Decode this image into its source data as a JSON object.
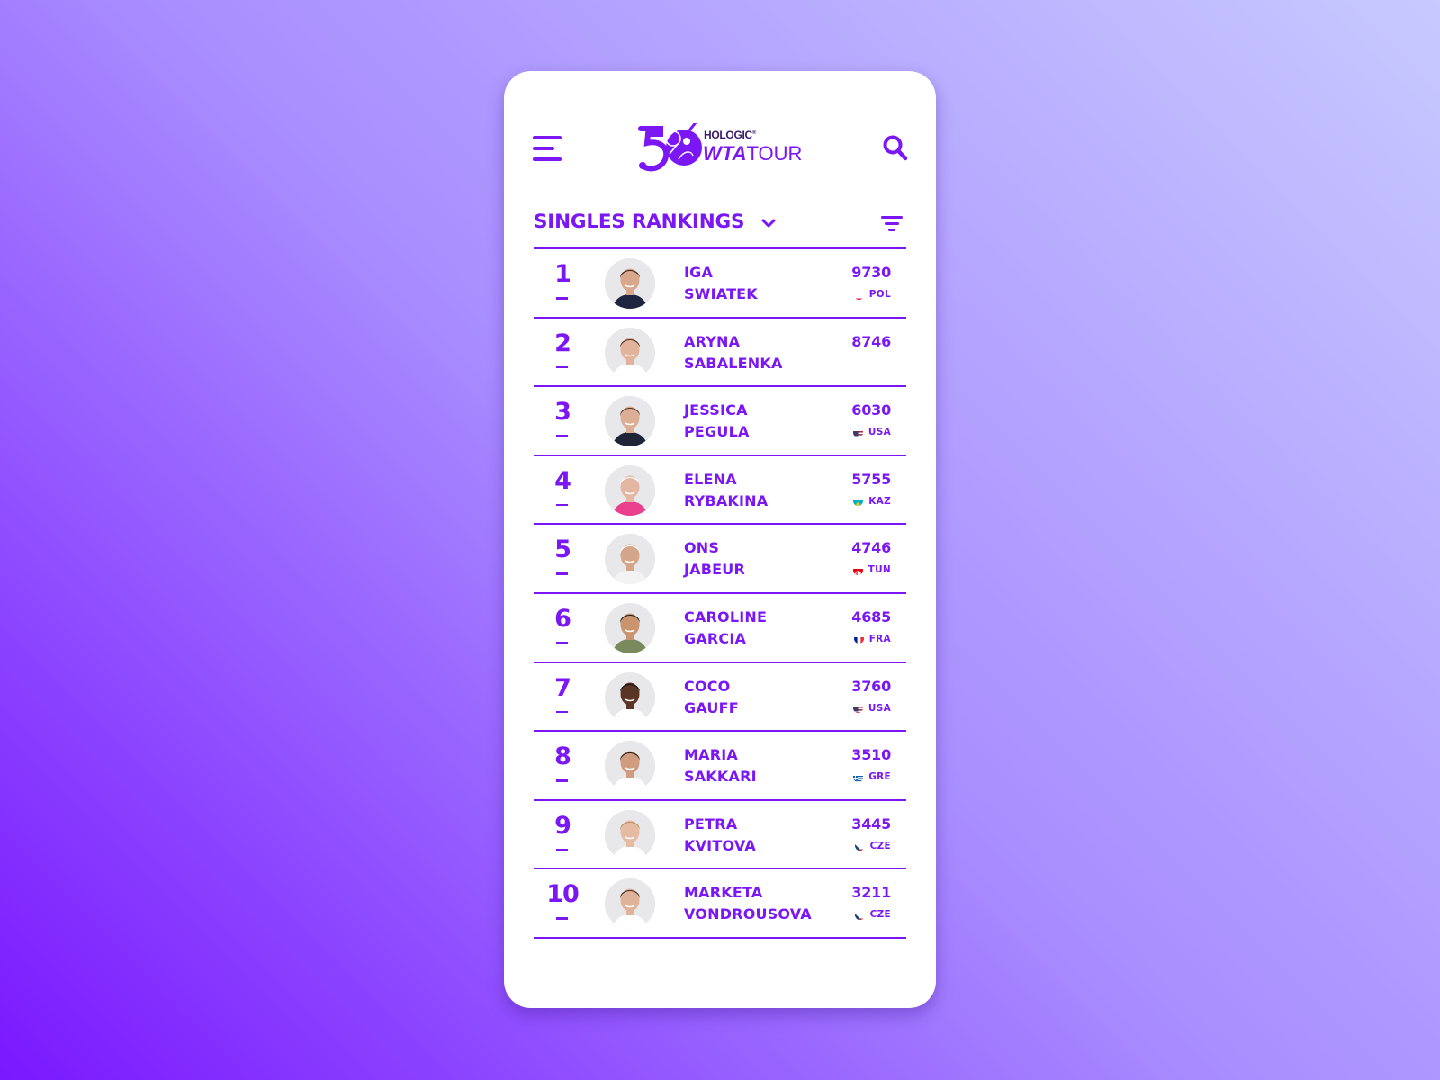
{
  "theme": {
    "accent": "#7b16f5",
    "background_from": "#7a17ff",
    "background_to": "#c7c9ff",
    "card": "#ffffff"
  },
  "header": {
    "menu_icon": "hamburger-menu-icon",
    "logo": {
      "number": "50",
      "sponsor": "HOLOGIC",
      "registered": "®",
      "brand_bold": "WTA",
      "brand_light": "TOUR"
    },
    "search_icon": "search-icon"
  },
  "section": {
    "title": "SINGLES RANKINGS",
    "dropdown_icon": "chevron-down-icon",
    "filter_icon": "filter-icon"
  },
  "rankings": [
    {
      "rank": "1",
      "first": "IGA",
      "last": "SWIATEK",
      "points": "9730",
      "country": "POL",
      "flag": "poland",
      "skin": "#d9a88c",
      "hair": "#3b2418",
      "shirt": "#1d2540"
    },
    {
      "rank": "2",
      "first": "ARYNA",
      "last": "SABALENKA",
      "points": "8746",
      "country": "",
      "flag": "",
      "skin": "#e2b29b",
      "hair": "#4a3424",
      "shirt": "#ffffff"
    },
    {
      "rank": "3",
      "first": "JESSICA",
      "last": "PEGULA",
      "points": "6030",
      "country": "USA",
      "flag": "usa",
      "skin": "#dcae96",
      "hair": "#5a3d27",
      "shirt": "#1f2438"
    },
    {
      "rank": "4",
      "first": "ELENA",
      "last": "RYBAKINA",
      "points": "5755",
      "country": "KAZ",
      "flag": "kazakhstan",
      "skin": "#e3b7a2",
      "hair": "#ffffff",
      "shirt": "#ea3f8c"
    },
    {
      "rank": "5",
      "first": "ONS",
      "last": "JABEUR",
      "points": "4746",
      "country": "TUN",
      "flag": "tunisia",
      "skin": "#d3a589",
      "hair": "#ffffff",
      "shirt": "#f3f3f3"
    },
    {
      "rank": "6",
      "first": "CAROLINE",
      "last": "GARCIA",
      "points": "4685",
      "country": "FRA",
      "flag": "france",
      "skin": "#c9946e",
      "hair": "#222222",
      "shirt": "#7a8a5c"
    },
    {
      "rank": "7",
      "first": "COCO",
      "last": "GAUFF",
      "points": "3760",
      "country": "USA",
      "flag": "usa",
      "skin": "#5a3525",
      "hair": "#1a1210",
      "shirt": "#ffffff"
    },
    {
      "rank": "8",
      "first": "MARIA",
      "last": "SAKKARI",
      "points": "3510",
      "country": "GRE",
      "flag": "greece",
      "skin": "#cf9c80",
      "hair": "#2d1d14",
      "shirt": "#ffffff"
    },
    {
      "rank": "9",
      "first": "PETRA",
      "last": "KVITOVA",
      "points": "3445",
      "country": "CZE",
      "flag": "czechia",
      "skin": "#e6bba4",
      "hair": "#b8926a",
      "shirt": "#ffffff"
    },
    {
      "rank": "10",
      "first": "MARKETA",
      "last": "VONDROUSOVA",
      "points": "3211",
      "country": "CZE",
      "flag": "czechia",
      "skin": "#dfb29a",
      "hair": "#4a3022",
      "shirt": "#ffffff"
    }
  ]
}
